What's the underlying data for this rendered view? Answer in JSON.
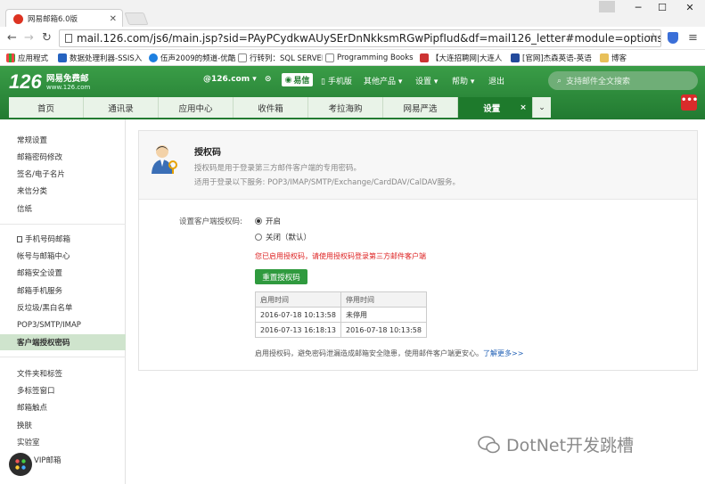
{
  "browser": {
    "tab_title": "网易邮箱6.0版",
    "url": "mail.126.com/js6/main.jsp?sid=PAyPCydkwAUySErDnNkksmRGwPipfIud&df=mail126_letter#module=options.LinkMod",
    "bookmarks": [
      "应用程式",
      "数据处理利器-SSIS入",
      "伍声2009的频道-优酷",
      "行转列：SQL SERVER",
      "Programming Books",
      "【大连招聘网|大连人",
      "[官网]杰森英语-英语",
      "博客"
    ]
  },
  "mail": {
    "logo": "126",
    "logo_sub": "网易免费邮",
    "logo_url": "www.126.com",
    "account": "@126.com",
    "yixin": "易信",
    "top_links": [
      "手机版",
      "其他产品",
      "设置",
      "帮助",
      "退出"
    ],
    "search_placeholder": "支持邮件全文搜索",
    "tabs": [
      "首页",
      "通讯录",
      "应用中心",
      "收件箱",
      "考拉海购",
      "网易严选",
      "设置"
    ]
  },
  "sidebar": {
    "group1": [
      "常规设置",
      "邮箱密码修改",
      "签名/电子名片",
      "来信分类",
      "信纸"
    ],
    "group2": [
      "手机号码邮箱",
      "帐号与邮箱中心",
      "邮箱安全设置",
      "邮箱手机服务",
      "反垃圾/黑白名单",
      "POP3/SMTP/IMAP",
      "客户端授权密码"
    ],
    "group3": [
      "文件夹和标签",
      "多标签窗口",
      "邮箱触点",
      "换肤",
      "实验室",
      "VIP邮箱"
    ],
    "active": "客户端授权密码"
  },
  "content": {
    "title": "授权码",
    "desc1": "授权码是用于登录第三方邮件客户端的专用密码。",
    "desc2": "适用于登录以下服务: POP3/IMAP/SMTP/Exchange/CardDAV/CalDAV服务。",
    "setting_label": "设置客户端授权码:",
    "option_on": "开启",
    "option_off": "关闭（默认）",
    "warning": "您已启用授权码，请使用授权码登录第三方邮件客户端",
    "reset_button": "重置授权码",
    "table_headers": [
      "启用时间",
      "停用时间"
    ],
    "table_rows": [
      [
        "2016-07-18 10:13:58",
        "未停用"
      ],
      [
        "2016-07-13 16:18:13",
        "2016-07-18 10:13:58"
      ]
    ],
    "footer": "启用授权码，避免密码泄漏造成邮箱安全隐患，使用邮件客户端更安心。",
    "learn_more": "了解更多>>"
  },
  "watermark": "DotNet开发跳槽"
}
